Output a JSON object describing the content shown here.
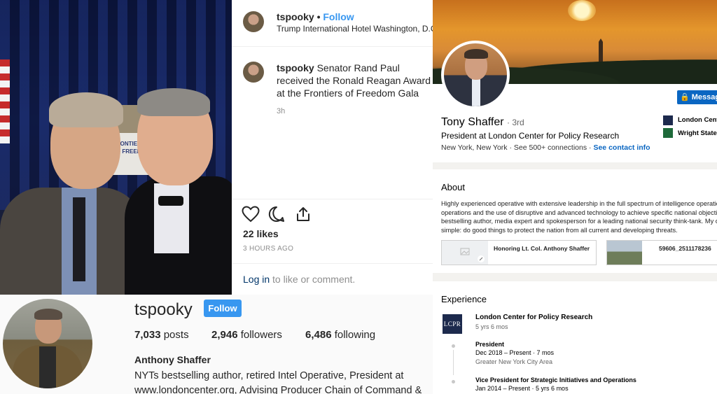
{
  "post": {
    "username": "tspooky",
    "follow_label": "Follow",
    "location": "Trump International Hotel Washington, D.C.",
    "caption_user": "tspooky",
    "caption_text": "Senator Rand Paul received the Ronald Reagan Award at the Frontiers of Freedom Gala",
    "caption_time": "3h",
    "likes": "22 likes",
    "posted": "3 HOURS AGO",
    "login_link": "Log in",
    "login_rest": "to like or comment.",
    "photo_banner_text": "FRONTIERS OF FREEDOM"
  },
  "profile": {
    "username": "tspooky",
    "follow_label": "Follow",
    "posts_count": "7,033",
    "posts_label": "posts",
    "followers_count": "2,946",
    "followers_label": "followers",
    "following_count": "6,486",
    "following_label": "following",
    "full_name": "Anthony Shaffer",
    "bio": "NYTs bestselling author, retired Intel Operative, President at www.londoncenter.org, Advising Producer Chain of Command &"
  },
  "linkedin": {
    "message_label": "Messag",
    "name": "Tony Shaffer",
    "degree": "· 3rd",
    "headline": "President at London Center for Policy Research",
    "location": "New York, New York",
    "connections": "See 500+ connections",
    "contact": "See contact info",
    "org1": "London Cent",
    "org2": "Wright State",
    "about_title": "About",
    "about_lines": [
      "Highly experienced operative with extensive leadership in the full spectrum of intelligence operation",
      "operations and the use of disruptive and advanced technology to achieve specific national objective",
      "bestselling author, media expert and spokesperson for a leading national security think-tank. My ob",
      "simple: do good things to protect the nation from all current and developing threats."
    ],
    "media1": "Honoring Lt. Col. Anthony Shaffer",
    "media2": "59606_2511178236",
    "experience_title": "Experience",
    "company_logo": "LCPR",
    "company": "London Center for Policy Research",
    "company_duration": "5 yrs 6 mos",
    "role1_title": "President",
    "role1_dates": "Dec 2018 – Present · 7 mos",
    "role1_location": "Greater New York City Area",
    "role2_title": "Vice President for Strategic Initiatives and Operations",
    "role2_dates": "Jan 2014 – Present · 5 yrs 6 mos",
    "colors": {
      "ig_blue": "#3897f0",
      "li_blue": "#0a66c2"
    }
  }
}
